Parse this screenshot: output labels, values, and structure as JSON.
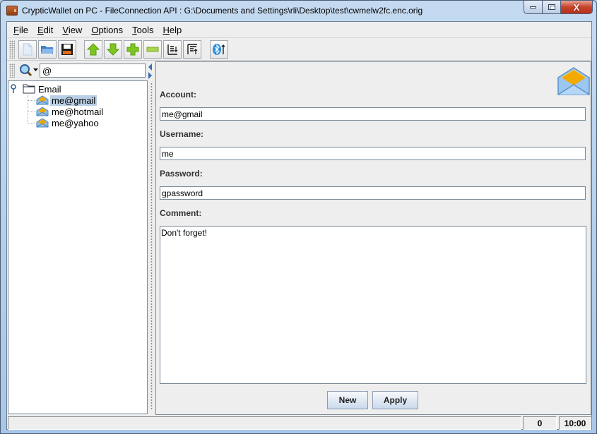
{
  "window": {
    "title": "CrypticWallet on PC - FileConnection API : G:\\Documents and Settings\\rli\\Desktop\\test\\cwmelw2fc.enc.orig",
    "controls": {
      "minimize": "minimize",
      "maximize": "maximize",
      "close": "X"
    }
  },
  "menu": [
    {
      "label": "File",
      "mnemonic": "F",
      "rest": "ile"
    },
    {
      "label": "Edit",
      "mnemonic": "E",
      "rest": "dit"
    },
    {
      "label": "View",
      "mnemonic": "V",
      "rest": "iew"
    },
    {
      "label": "Options",
      "mnemonic": "O",
      "rest": "ptions"
    },
    {
      "label": "Tools",
      "mnemonic": "T",
      "rest": "ools"
    },
    {
      "label": "Help",
      "mnemonic": "H",
      "rest": "elp"
    }
  ],
  "toolbar": {
    "buttons": [
      {
        "id": "new-file",
        "icon": "new-document-icon"
      },
      {
        "id": "open",
        "icon": "open-folder-icon"
      },
      {
        "id": "save",
        "icon": "floppy-disk-icon"
      },
      {
        "id": "move-up",
        "icon": "arrow-up-icon"
      },
      {
        "id": "move-down",
        "icon": "arrow-down-icon"
      },
      {
        "id": "add",
        "icon": "plus-icon"
      },
      {
        "id": "remove",
        "icon": "minus-icon"
      },
      {
        "id": "sort-descending",
        "icon": "sort-down-icon"
      },
      {
        "id": "sort-ascending",
        "icon": "sort-up-icon"
      },
      {
        "id": "bluetooth-send",
        "icon": "bluetooth-upload-icon"
      }
    ]
  },
  "search": {
    "value": "@",
    "icon": "search-icon"
  },
  "tree": {
    "root": {
      "label": "Email",
      "icon": "folder-icon"
    },
    "items": [
      {
        "label": "me@gmail",
        "selected": true,
        "icon": "envelope-icon"
      },
      {
        "label": "me@hotmail",
        "selected": false,
        "icon": "envelope-icon"
      },
      {
        "label": "me@yahoo",
        "selected": false,
        "icon": "envelope-icon"
      }
    ]
  },
  "form": {
    "account_label": "Account:",
    "account_value": "me@gmail",
    "username_label": "Username:",
    "username_value": "me",
    "password_label": "Password:",
    "password_value": "gpassword",
    "comment_label": "Comment:",
    "comment_value": "Don't forget!",
    "new_button": "New",
    "apply_button": "Apply"
  },
  "status": {
    "message": "",
    "count": "0",
    "time": "10:00"
  },
  "colors": {
    "selection": "#b8cfe5",
    "envelope_blue": "#7fb2e5",
    "envelope_gold": "#f0a800",
    "toolbar_green": "#7cc61f"
  }
}
